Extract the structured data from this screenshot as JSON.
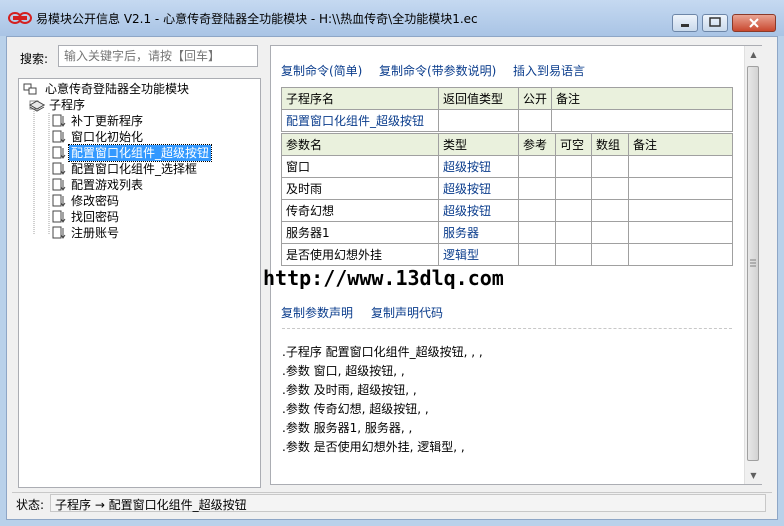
{
  "window": {
    "title": "易模块公开信息 V2.1 - 心意传奇登陆器全功能模块 - H:\\\\热血传奇\\全功能模块1.ec"
  },
  "search": {
    "label": "搜索:",
    "placeholder": "输入关键字后，请按【回车】"
  },
  "tree": {
    "root": "心意传奇登陆器全功能模块",
    "group": "子程序",
    "items": [
      "补丁更新程序",
      "窗口化初始化",
      "配置窗口化组件_超级按钮",
      "配置窗口化组件_选择框",
      "配置游戏列表",
      "修改密码",
      "找回密码",
      "注册账号"
    ],
    "selected_index": 2
  },
  "actions": {
    "copy_simple": "复制命令(简单)",
    "copy_with_params": "复制命令(带参数说明)",
    "insert": "插入到易语言"
  },
  "sub_table": {
    "headers": [
      "子程序名",
      "返回值类型",
      "公开",
      "备注"
    ],
    "row": [
      "配置窗口化组件_超级按钮",
      "",
      "",
      ""
    ]
  },
  "param_table": {
    "headers": [
      "参数名",
      "类型",
      "参考",
      "可空",
      "数组",
      "备注"
    ],
    "rows": [
      [
        "窗口",
        "超级按钮"
      ],
      [
        "及时雨",
        "超级按钮"
      ],
      [
        "传奇幻想",
        "超级按钮"
      ],
      [
        "服务器1",
        "服务器"
      ],
      [
        "是否使用幻想外挂",
        "逻辑型"
      ]
    ]
  },
  "watermark": "http://www.13dlq.com",
  "decl_actions": {
    "copy_param_decl": "复制参数声明",
    "copy_decl_code": "复制声明代码"
  },
  "code_lines": [
    ".子程序 配置窗口化组件_超级按钮, , ,",
    ".参数 窗口, 超级按钮, ,",
    ".参数 及时雨, 超级按钮, ,",
    ".参数 传奇幻想, 超级按钮, ,",
    ".参数 服务器1, 服务器, ,",
    ".参数 是否使用幻想外挂, 逻辑型, ,"
  ],
  "status": {
    "label": "状态:",
    "text": "子程序 → 配置窗口化组件_超级按钮"
  },
  "colors": {
    "link": "#0a3c8c",
    "table_header": "#eaf1dd",
    "selection": "#3399ff"
  }
}
